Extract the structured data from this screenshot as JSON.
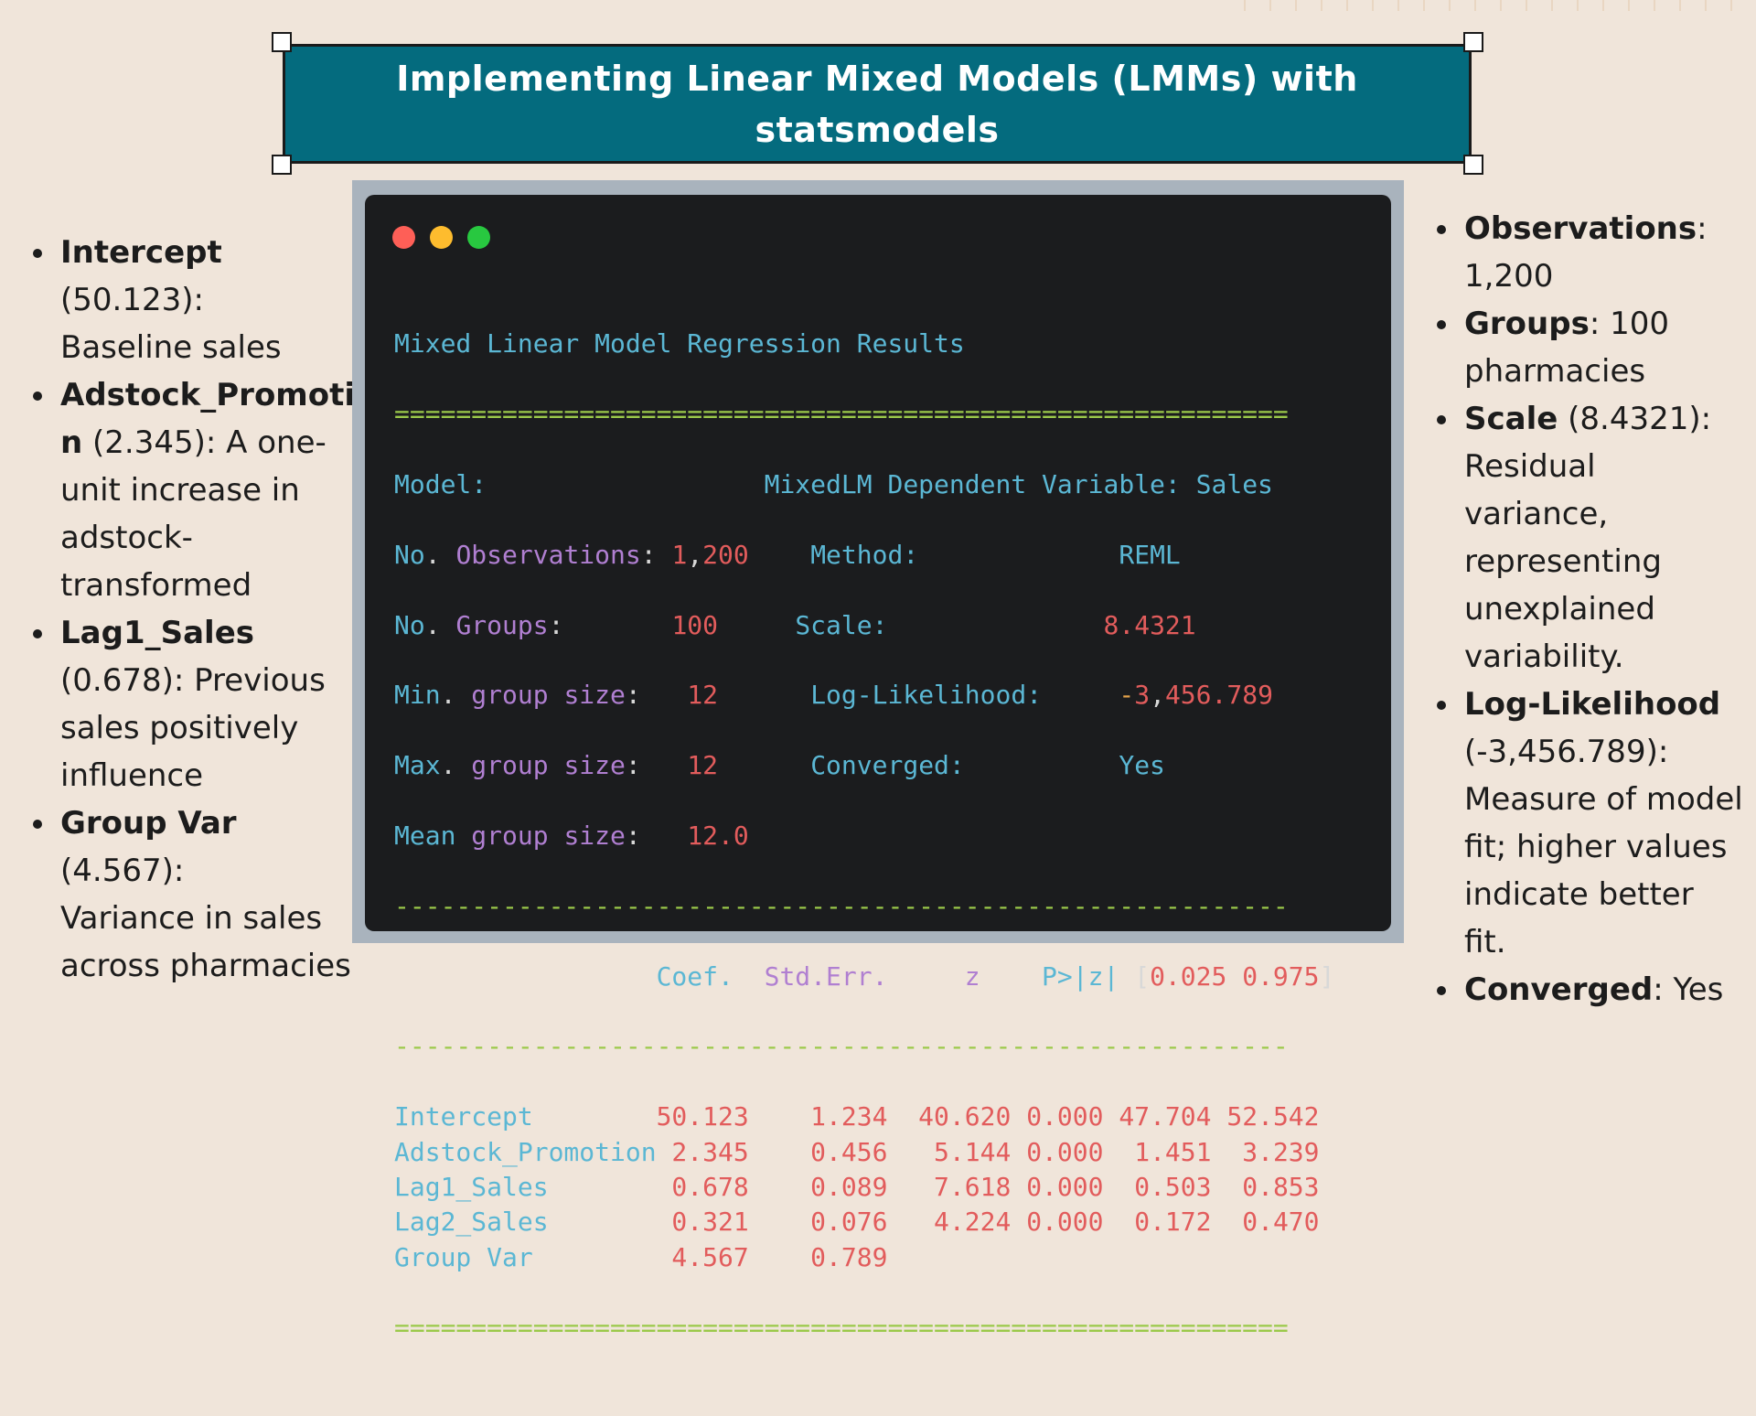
{
  "title": "Implementing Linear Mixed Models (LMMs) with statsmodels",
  "left_bullets": [
    {
      "term": "Intercept",
      "value": " (50.123):",
      "desc": "Baseline sales"
    },
    {
      "term": "Adstock_Promotion",
      "value": " (2.345): A one-unit increase in adstock-transformed",
      "desc": ""
    },
    {
      "term": "Lag1_Sales",
      "value": " (0.678): Previous sales positively influence",
      "desc": ""
    },
    {
      "term": "Group Var",
      "value": " (4.567):",
      "desc": "Variance in sales across pharmacies"
    }
  ],
  "right_bullets": [
    {
      "term": "Observations",
      "rest": ": 1,200"
    },
    {
      "term": "Groups",
      "rest": ": 100 pharmacies"
    },
    {
      "term": "Scale",
      "rest": " (8.4321): Residual variance, representing unexplained variability."
    },
    {
      "term": "Log-Likelihood",
      "rest": " (-3,456.789): Measure of model fit; higher values indicate better fit."
    },
    {
      "term": "Converged",
      "rest": ": Yes"
    }
  ],
  "terminal": {
    "colors": {
      "close": "#fe5f57",
      "minimize": "#febc2e",
      "maximize": "#28c840"
    },
    "heading": "Mixed Linear Model Regression Results",
    "rule_double": "==========================================================",
    "rule_single": "----------------------------------------------------------",
    "summary": {
      "model_label": "Model:",
      "model_value": "MixedLM",
      "dep_label": "Dependent Variable:",
      "dep_value": "Sales",
      "obs_label": "No. Observations:",
      "obs_value": "1,200",
      "method_label": "Method:",
      "method_value": "REML",
      "groups_label": "No. Groups:",
      "groups_value": "100",
      "scale_label": "Scale:",
      "scale_value": "8.4321",
      "min_label": "Min. group size:",
      "min_value": "12",
      "ll_label": "Log-Likelihood:",
      "ll_value": "-3,456.789",
      "max_label": "Max. group size:",
      "max_value": "12",
      "conv_label": "Converged:",
      "conv_value": "Yes",
      "mean_label": "Mean group size:",
      "mean_value": "12.0"
    },
    "table_header": {
      "coef": "Coef.",
      "stderr": "Std.Err.",
      "z": "z",
      "p": "P>|z|",
      "ci_open": "[",
      "ci_lo": "0.025",
      "ci_hi": "0.975",
      "ci_close": "]"
    },
    "rows": [
      {
        "name": "Intercept",
        "coef": "50.123",
        "se": "1.234",
        "z": "40.620",
        "p": "0.000",
        "lo": "47.704",
        "hi": "52.542"
      },
      {
        "name": "Adstock_Promotion",
        "coef": "2.345",
        "se": "0.456",
        "z": "5.144",
        "p": "0.000",
        "lo": "1.451",
        "hi": "3.239"
      },
      {
        "name": "Lag1_Sales",
        "coef": "0.678",
        "se": "0.089",
        "z": "7.618",
        "p": "0.000",
        "lo": "0.503",
        "hi": "0.853"
      },
      {
        "name": "Lag2_Sales",
        "coef": "0.321",
        "se": "0.076",
        "z": "4.224",
        "p": "0.000",
        "lo": "0.172",
        "hi": "0.470"
      },
      {
        "name": "Group Var",
        "coef": "4.567",
        "se": "0.789",
        "z": "",
        "p": "",
        "lo": "",
        "hi": ""
      }
    ]
  }
}
